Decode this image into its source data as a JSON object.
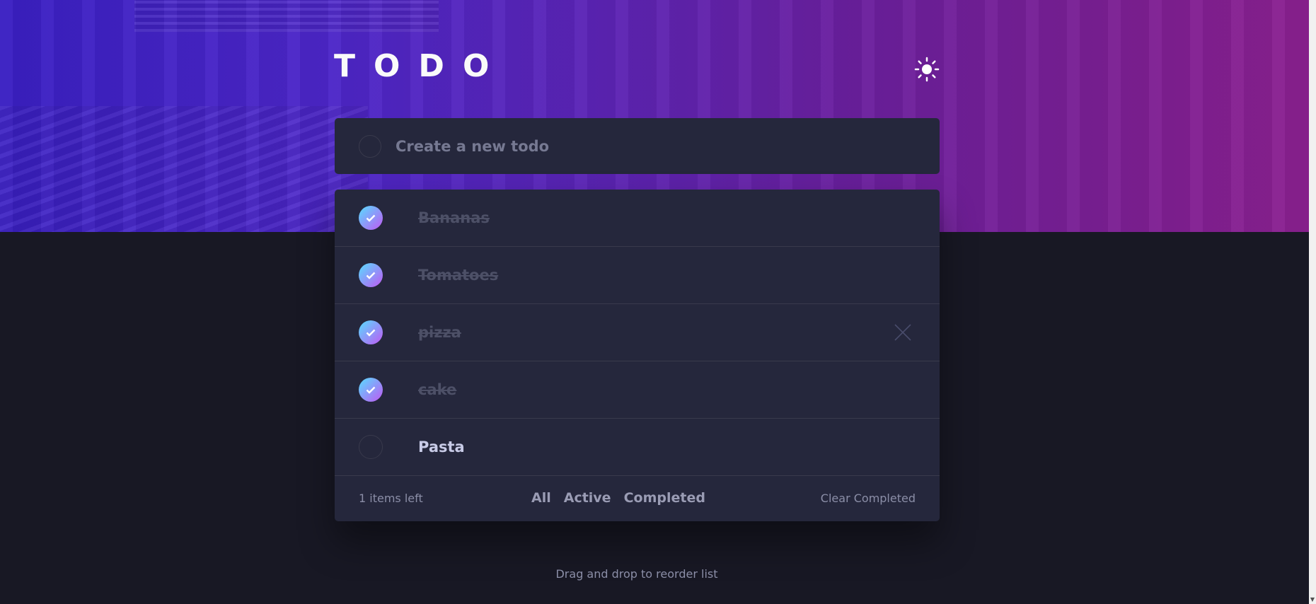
{
  "header": {
    "title": "TODO",
    "theme_icon": "sun-icon"
  },
  "new_todo": {
    "placeholder": "Create a new todo",
    "value": ""
  },
  "todos": [
    {
      "label": "Bananas",
      "completed": true
    },
    {
      "label": "Tomatoes",
      "completed": true
    },
    {
      "label": "pizza",
      "completed": true
    },
    {
      "label": "cake",
      "completed": true
    },
    {
      "label": "Pasta",
      "completed": false
    }
  ],
  "footer": {
    "items_left": "1 items left",
    "filter_all": "All",
    "filter_active": "Active",
    "filter_completed": "Completed",
    "clear_completed": "Clear Completed"
  },
  "hint": "Drag and drop to reorder list",
  "colors": {
    "card": "#25273c",
    "background": "#181824",
    "check_gradient_start": "#57ddff",
    "check_gradient_end": "#c058f3",
    "completed_text": "#4d5067",
    "active_text": "#c8cbe7"
  }
}
